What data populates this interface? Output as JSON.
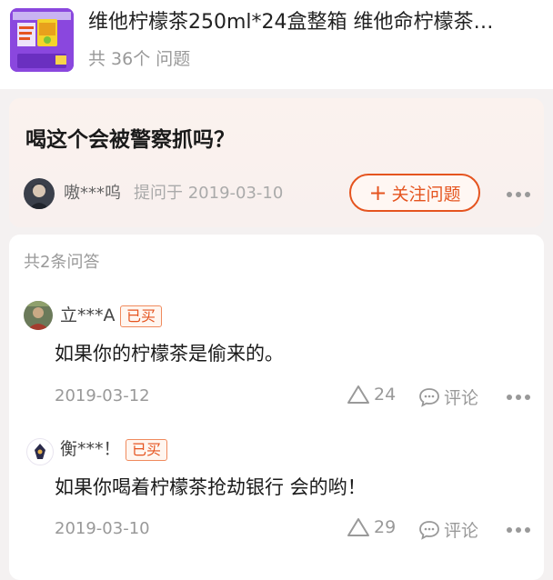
{
  "product": {
    "title": "维他柠檬茶250ml*24盒整箱 维他命柠檬茶…",
    "question_count": "共 36个 问题"
  },
  "question": {
    "text": "喝这个会被警察抓吗？",
    "asker_name": "嗷***呜",
    "asked_time": "提问于 2019-03-10",
    "follow_label": "关注问题",
    "follow_icon": "plus-icon"
  },
  "answers_header": "共2条问答",
  "answers": [
    {
      "user": "立***A",
      "badge": "已买",
      "text": "如果你的柠檬茶是偷来的。",
      "date": "2019-03-12",
      "likes": "24",
      "comment_label": "评论"
    },
    {
      "user": "衡***！",
      "badge": "已买",
      "text": "如果你喝着柠檬茶抢劫银行  会的哟！",
      "date": "2019-03-10",
      "likes": "29",
      "comment_label": "评论"
    }
  ],
  "colors": {
    "accent": "#e5541f",
    "muted": "#999999",
    "question_bg": "#fbf2ee"
  }
}
